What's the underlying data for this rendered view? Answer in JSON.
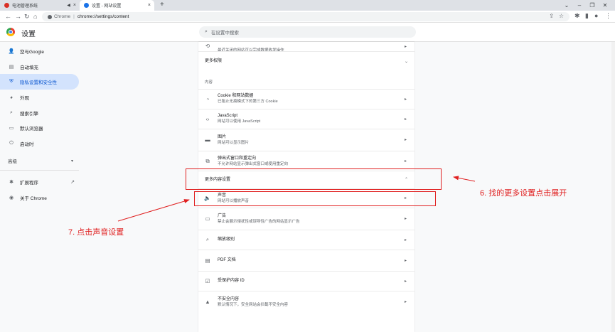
{
  "tabs": [
    {
      "title": "电池管理系统",
      "favicon_color": "#d93025",
      "close": "×"
    },
    {
      "title": "设置 - 网站设置",
      "favicon_color": "#1a73e8",
      "close": "×"
    }
  ],
  "new_tab": "+",
  "window_controls": {
    "dropdown": "⌄",
    "minimize": "–",
    "maximize": "❐",
    "close": "✕"
  },
  "toolbar": {
    "back": "←",
    "forward": "→",
    "reload": "↻",
    "home": "⌂",
    "scheme": "Chrome",
    "separator": "|",
    "url": "chrome://settings/content",
    "share": "⇪",
    "star": "☆",
    "extensions": "✱",
    "sidepanel": "▮",
    "profile": "●",
    "menu": "⋮"
  },
  "header": {
    "title": "设置",
    "search_placeholder": "在设置中搜索"
  },
  "sidebar": {
    "items": [
      {
        "label": "您与Google",
        "icon": "person-icon",
        "glyph": "👤"
      },
      {
        "label": "自动填充",
        "icon": "autofill-icon",
        "glyph": "▤"
      },
      {
        "label": "隐私设置和安全性",
        "icon": "shield-icon",
        "glyph": "⛨",
        "active": true
      },
      {
        "label": "外观",
        "icon": "palette-icon",
        "glyph": "◕"
      },
      {
        "label": "搜索引擎",
        "icon": "search-icon",
        "glyph": "⌕"
      },
      {
        "label": "默认浏览器",
        "icon": "browser-icon",
        "glyph": "▭"
      },
      {
        "label": "启动时",
        "icon": "power-icon",
        "glyph": "⏻"
      }
    ],
    "advanced": {
      "label": "高级",
      "caret": "▾"
    },
    "extensions": {
      "label": "扩展程序",
      "icon": "puzzle-icon",
      "glyph": "✱",
      "ext_glyph": "↗"
    },
    "about": {
      "label": "关于 Chrome",
      "icon": "chrome-icon",
      "glyph": "◉"
    }
  },
  "content": {
    "top_row": {
      "l2": "最近关闭的网站可以完成数据收发操作",
      "icon_glyph": "⟲"
    },
    "more_permissions": {
      "label": "更多权限",
      "chevron": "⌄"
    },
    "section_content": "内容",
    "rows": [
      {
        "name": "cookies",
        "l1": "Cookie 和网站数据",
        "l2": "已阻止无痕模式下的第三方 Cookie",
        "icon": "cookie-icon",
        "glyph": "◔"
      },
      {
        "name": "javascript",
        "l1": "JavaScript",
        "l2": "网站可以使用 JavaScript",
        "icon": "code-icon",
        "glyph": "‹›"
      },
      {
        "name": "images",
        "l1": "图片",
        "l2": "网站可以显示图片",
        "icon": "image-icon",
        "glyph": "▬"
      },
      {
        "name": "popups",
        "l1": "弹出式窗口和重定向",
        "l2": "不允许网站显示弹出式窗口或使用重定向",
        "icon": "popup-icon",
        "glyph": "⧉"
      }
    ],
    "more_content": {
      "label": "更多内容设置",
      "chevron": "⌃"
    },
    "rows2": [
      {
        "name": "sound",
        "l1": "声音",
        "l2": "网站可以播放声音",
        "icon": "speaker-icon",
        "glyph": "🔈"
      },
      {
        "name": "ads",
        "l1": "广告",
        "l2": "禁止会展示侵扰性或误导性广告的网站显示广告",
        "icon": "ads-icon",
        "glyph": "▭"
      },
      {
        "name": "zoom",
        "l1": "缩放级别",
        "l2": "",
        "icon": "zoom-icon",
        "glyph": "⌕"
      },
      {
        "name": "pdf",
        "l1": "PDF 文档",
        "l2": "",
        "icon": "pdf-icon",
        "glyph": "▤"
      },
      {
        "name": "protected",
        "l1": "受保护内容 ID",
        "l2": "",
        "icon": "protected-icon",
        "glyph": "☑"
      },
      {
        "name": "insecure",
        "l1": "不安全内容",
        "l2": "默认情况下，安全网站会拦截不安全内容",
        "icon": "warning-icon",
        "glyph": "▲"
      }
    ],
    "arrow": "▸"
  },
  "annotations": {
    "step6": "6. 找的更多设置点击展开",
    "step7": "7. 点击声音设置",
    "color": "#e02020"
  }
}
